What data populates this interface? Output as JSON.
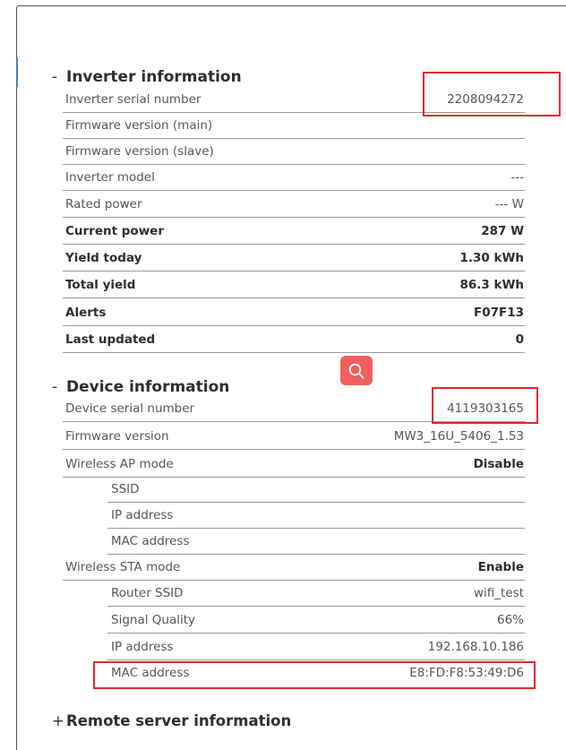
{
  "inverter": {
    "toggle": "-",
    "title": "Inverter information",
    "rows": [
      {
        "label": "Inverter serial number",
        "value": "2208094272"
      },
      {
        "label": "Firmware version (main)",
        "value": ""
      },
      {
        "label": "Firmware version (slave)",
        "value": ""
      },
      {
        "label": "Inverter model",
        "value": "---"
      },
      {
        "label": "Rated power",
        "value": "--- W"
      },
      {
        "label": "Current power",
        "value": "287 W"
      },
      {
        "label": "Yield today",
        "value": "1.30 kWh"
      },
      {
        "label": "Total yield",
        "value": "86.3 kWh"
      },
      {
        "label": "Alerts",
        "value": "F07F13"
      },
      {
        "label": "Last updated",
        "value": "0"
      }
    ]
  },
  "device": {
    "toggle": "-",
    "title": "Device information",
    "rows": [
      {
        "label": "Device serial number",
        "value": "4119303165"
      },
      {
        "label": "Firmware version",
        "value": "MW3_16U_5406_1.53"
      },
      {
        "label": "Wireless AP mode",
        "value": "Disable"
      },
      {
        "label": "SSID",
        "value": ""
      },
      {
        "label": "IP address",
        "value": ""
      },
      {
        "label": "MAC address",
        "value": ""
      },
      {
        "label": "Wireless STA mode",
        "value": "Enable"
      },
      {
        "label": "Router SSID",
        "value": "wifi_test"
      },
      {
        "label": "Signal Quality",
        "value": "66%"
      },
      {
        "label": "IP address",
        "value": "192.168.10.186"
      },
      {
        "label": "MAC address",
        "value": "E8:FD:F8:53:49:D6"
      }
    ]
  },
  "remote": {
    "toggle": "+",
    "title": "Remote server information"
  },
  "icons": {
    "search": "search-icon"
  },
  "colors": {
    "highlight": "#e02a2a",
    "search_button": "#f0605f",
    "accent_edge": "#4a7fc0"
  }
}
